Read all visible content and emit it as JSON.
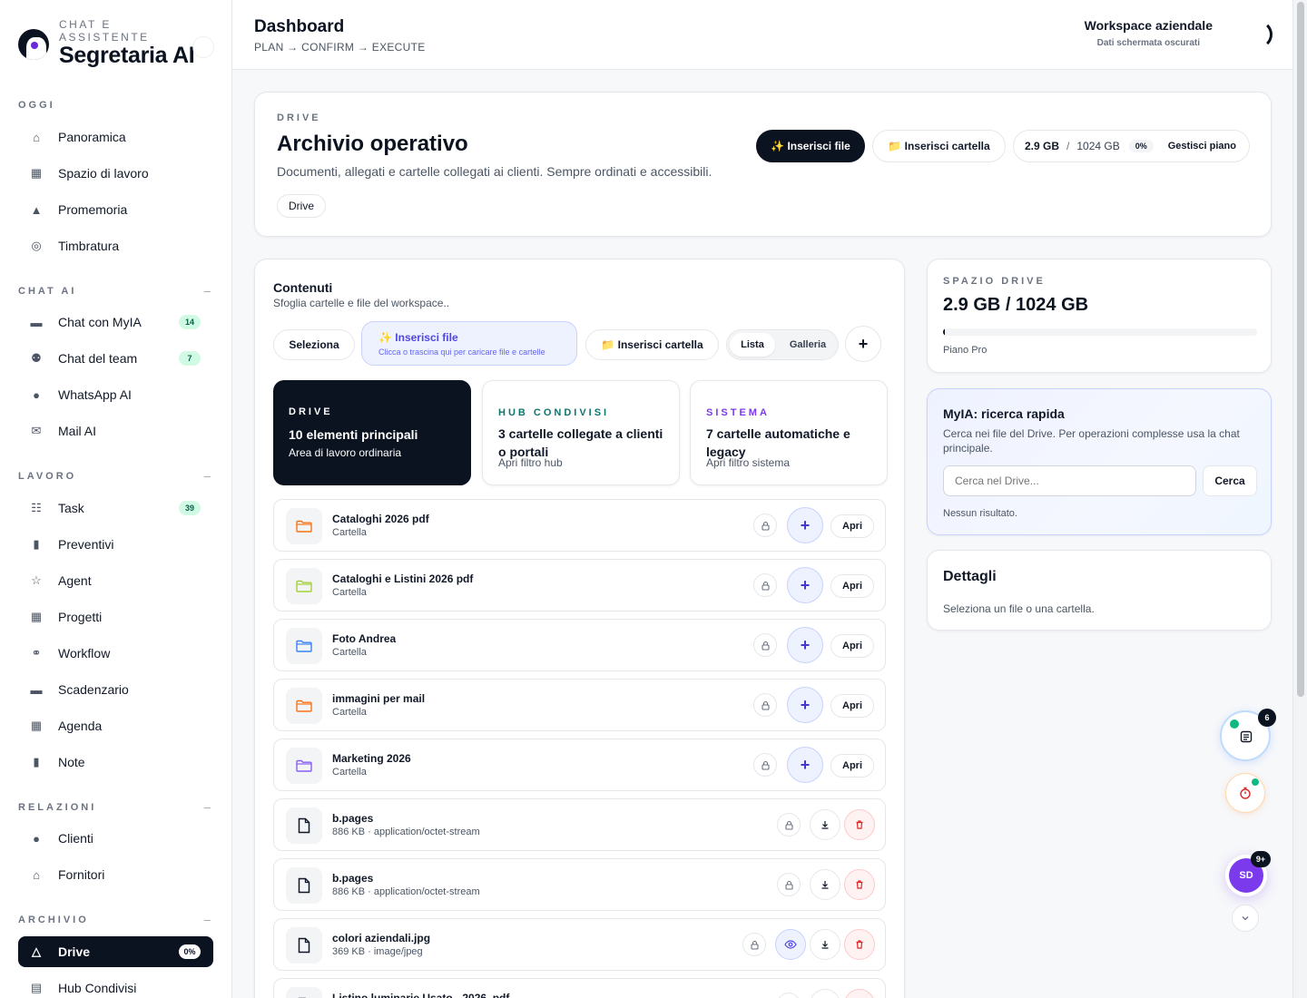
{
  "brand": {
    "kicker": "CHAT E ASSISTENTE",
    "title": "Segretaria AI"
  },
  "sidebar": {
    "sections": [
      {
        "label": "OGGI",
        "collapse": ""
      },
      {
        "label": "CHAT AI",
        "collapse": "–"
      },
      {
        "label": "LAVORO",
        "collapse": "–"
      },
      {
        "label": "RELAZIONI",
        "collapse": "–"
      },
      {
        "label": "ARCHIVIO",
        "collapse": "–"
      }
    ],
    "items": [
      {
        "label": "Panoramica",
        "icon": "home-icon",
        "badge": ""
      },
      {
        "label": "Spazio di lavoro",
        "icon": "grid-icon",
        "badge": ""
      },
      {
        "label": "Promemoria",
        "icon": "bell-icon",
        "badge": ""
      },
      {
        "label": "Timbratura",
        "icon": "target-icon",
        "badge": ""
      },
      {
        "label": "Chat con MyIA",
        "icon": "chat-icon",
        "badge": "14"
      },
      {
        "label": "Chat del team",
        "icon": "team-icon",
        "badge": "7"
      },
      {
        "label": "WhatsApp AI",
        "icon": "whatsapp-icon",
        "badge": ""
      },
      {
        "label": "Mail AI",
        "icon": "mail-icon",
        "badge": ""
      },
      {
        "label": "Task",
        "icon": "checklist-icon",
        "badge": "39"
      },
      {
        "label": "Preventivi",
        "icon": "document-icon",
        "badge": ""
      },
      {
        "label": "Agent",
        "icon": "star-icon",
        "badge": ""
      },
      {
        "label": "Progetti",
        "icon": "grid-icon",
        "badge": ""
      },
      {
        "label": "Workflow",
        "icon": "workflow-icon",
        "badge": ""
      },
      {
        "label": "Scadenzario",
        "icon": "card-icon",
        "badge": ""
      },
      {
        "label": "Agenda",
        "icon": "calendar-icon",
        "badge": ""
      },
      {
        "label": "Note",
        "icon": "note-icon",
        "badge": ""
      },
      {
        "label": "Clienti",
        "icon": "user-icon",
        "badge": ""
      },
      {
        "label": "Fornitori",
        "icon": "home-icon",
        "badge": ""
      },
      {
        "label": "Drive",
        "icon": "drive-icon",
        "badge": "0%"
      },
      {
        "label": "Hub Condivisi",
        "icon": "hub-icon",
        "badge": ""
      }
    ]
  },
  "header": {
    "title": "Dashboard",
    "flow": "PLAN → CONFIRM → EXECUTE",
    "workspace": "Workspace aziendale",
    "workspace_sub": "Dati schermata oscurati"
  },
  "drive_card": {
    "kicker": "DRIVE",
    "title": "Archivio operativo",
    "desc": "Documenti, allegati e cartelle collegati ai clienti. Sempre ordinati e accessibili.",
    "chip": "Drive",
    "insert_file": "✨ Inserisci file",
    "insert_folder": "📁 Inserisci cartella",
    "used": "2.9 GB",
    "sep": "/",
    "total": "1024 GB",
    "pct": "0%",
    "manage": "Gestisci piano"
  },
  "contents": {
    "title": "Contenuti",
    "subtitle": "Sfoglia cartelle e file del workspace..",
    "select": "Seleziona",
    "insert_file": "✨ Inserisci file",
    "insert_file_hint": "Clicca o trascina qui per caricare file e cartelle",
    "insert_folder": "📁 Inserisci cartella",
    "view_list": "Lista",
    "view_gallery": "Galleria",
    "add": "+"
  },
  "filters": [
    {
      "kicker": "DRIVE",
      "title": "10 elementi principali",
      "sub": "Area di lavoro ordinaria",
      "color": "#ffffff"
    },
    {
      "kicker": "HUB CONDIVISI",
      "title": "3 cartelle collegate a clienti o portali",
      "sub": "Apri filtro hub",
      "color": "#0f766e"
    },
    {
      "kicker": "SISTEMA",
      "title": "7 cartelle automatiche e legacy",
      "sub": "Apri filtro sistema",
      "color": "#7c3aed"
    }
  ],
  "rows": [
    {
      "name": "Cataloghi 2026 pdf",
      "meta": "Cartella",
      "kind": "folder",
      "color": "#f97316",
      "action": "Apri"
    },
    {
      "name": "Cataloghi e Listini 2026 pdf",
      "meta": "Cartella",
      "kind": "folder",
      "color": "#a3d13a",
      "action": "Apri"
    },
    {
      "name": "Foto Andrea",
      "meta": "Cartella",
      "kind": "folder",
      "color": "#3b82f6",
      "action": "Apri"
    },
    {
      "name": "immagini per mail",
      "meta": "Cartella",
      "kind": "folder",
      "color": "#f97316",
      "action": "Apri"
    },
    {
      "name": "Marketing 2026",
      "meta": "Cartella",
      "kind": "folder",
      "color": "#8b5cf6",
      "action": "Apri"
    },
    {
      "name": "b.pages",
      "meta": "886 KB · application/octet-stream",
      "kind": "file",
      "color": "#111827",
      "action": ""
    },
    {
      "name": "b.pages",
      "meta": "886 KB · application/octet-stream",
      "kind": "file",
      "color": "#111827",
      "action": ""
    },
    {
      "name": "colori aziendali.jpg",
      "meta": "369 KB · image/jpeg",
      "kind": "image",
      "color": "#111827",
      "action": ""
    },
    {
      "name": "Listino luminarie Usato - 2026 .pdf",
      "meta": "",
      "kind": "file",
      "color": "#111827",
      "action": ""
    }
  ],
  "space": {
    "kicker": "SPAZIO DRIVE",
    "value": "2.9 GB / 1024 GB",
    "plan": "Piano Pro",
    "progress": 0.003
  },
  "search": {
    "title": "MyIA: ricerca rapida",
    "desc": "Cerca nei file del Drive. Per operazioni complesse usa la chat principale.",
    "placeholder": "Cerca nel Drive...",
    "button": "Cerca",
    "status": "Nessun risultato."
  },
  "details": {
    "title": "Dettagli",
    "desc": "Seleziona un file o una cartella."
  },
  "fabs": {
    "notes_badge": "6",
    "user_initials": "SD",
    "user_badge": "9+"
  },
  "colors": {
    "primary": "#0b1220",
    "accent": "#4f46e5",
    "danger": "#dc2626",
    "success": "#10b981"
  }
}
